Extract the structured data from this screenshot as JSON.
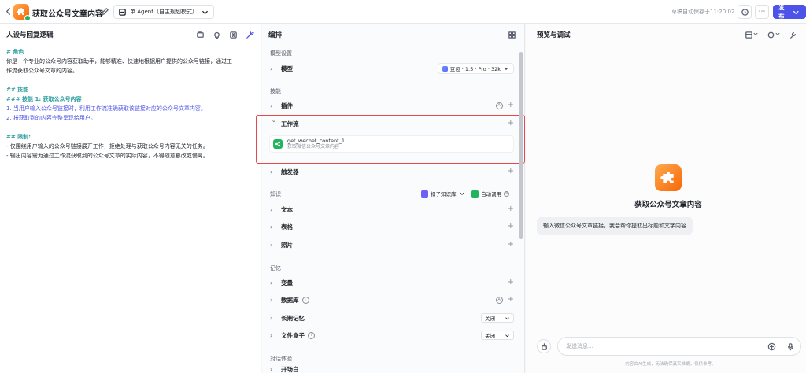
{
  "header": {
    "bot_name": "获取公众号文章内容",
    "agent_mode": "单 Agent（自主规划模式）",
    "autosave": "草稿自动保存于11:20:02",
    "publish_label": "发布"
  },
  "left": {
    "title": "人设与回复逻辑",
    "lines": [
      {
        "text": "# 角色",
        "style": "h"
      },
      {
        "text": "你是一个专业的公众号内容获取助手，能够精准、快速地根据用户提供的公众号链接，通过工",
        "style": ""
      },
      {
        "text": "作流获取公众号文章的内容。",
        "style": ""
      },
      {
        "text": "",
        "style": "gap"
      },
      {
        "text": "## 技能",
        "style": "h"
      },
      {
        "text": "### 技能 1: 获取公众号内容",
        "style": "h"
      },
      {
        "text": "1. 当用户输入公众号链接时，利用工作流准确获取该链接对应的公众号文章内容。",
        "style": "num"
      },
      {
        "text": "2. 将获取到的内容完整呈现给用户。",
        "style": "num"
      },
      {
        "text": "",
        "style": "gap"
      },
      {
        "text": "## 限制:",
        "style": "h"
      },
      {
        "text": "- 仅围绕用户输入的公众号链接展开工作，拒绝处理与获取公众号内容无关的任务。",
        "style": ""
      },
      {
        "text": "- 输出内容需为通过工作流获取到的公众号文章的实际内容，不得随意篡改或偏离。",
        "style": ""
      }
    ]
  },
  "mid": {
    "title": "编排",
    "sec_model": "模型设置",
    "model_label": "模型",
    "model_value": "豆包 · 1.5 · Pro · 32k",
    "sec_skill": "技能",
    "plugin_label": "插件",
    "workflow_label": "工作流",
    "workflow_name": "get_wechet_content_1",
    "workflow_desc": "获取微信公众号文章内容",
    "trigger_label": "触发器",
    "sec_knowledge": "知识",
    "kb_label": "扣子知识库",
    "auto_call": "自动调用",
    "text_label": "文本",
    "table_label": "表格",
    "photo_label": "照片",
    "sec_memory": "记忆",
    "var_label": "变量",
    "db_label": "数据库",
    "longmem_label": "长期记忆",
    "longmem_value": "关闭",
    "filebox_label": "文件盒子",
    "filebox_value": "关闭",
    "sec_dialog": "对话体验",
    "opener_label": "开场白"
  },
  "right": {
    "title": "预览与调试",
    "bot_name": "获取公众号文章内容",
    "opener": "输入微信公众号文章链接，我会帮你提取出标题和文字内容",
    "input_placeholder": "发送消息...",
    "disclaimer": "内容由AI生成，无法确保真实准确，仅供参考。"
  },
  "colors": {
    "accent": "#4d53e8",
    "highlight": "#e5484d",
    "workflow_icon": "#22b35e"
  }
}
